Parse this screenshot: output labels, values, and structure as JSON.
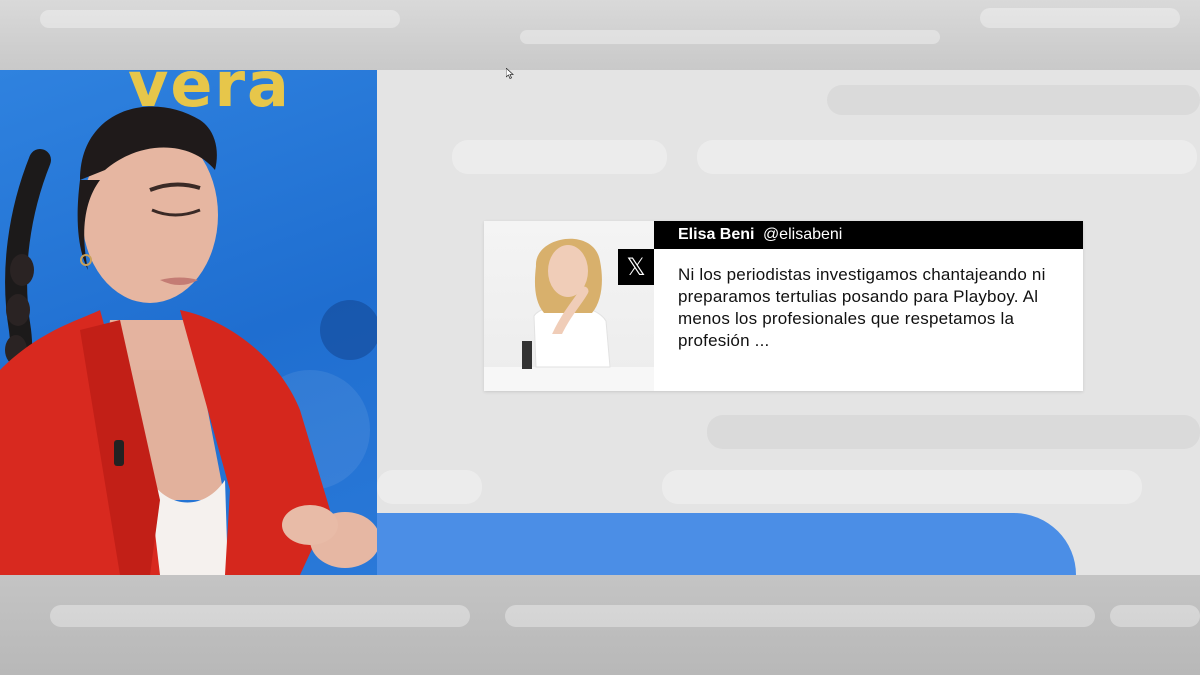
{
  "background_text": "vera",
  "tweet": {
    "platform_icon": "x-logo-icon",
    "platform_glyph": "𝕏",
    "author_name": "Elisa Beni",
    "author_handle": "@elisabeni",
    "text": "Ni los periodistas investigamos chantajeando ni preparamos tertulias posando para Playboy. Al menos los profesionales que respetamos la profesión ..."
  },
  "colors": {
    "studio_blue": "#2a79d8",
    "lower_bar_blue": "#4b8ee6",
    "tweet_header_bg": "#000000",
    "jacket_red": "#d8291f"
  }
}
